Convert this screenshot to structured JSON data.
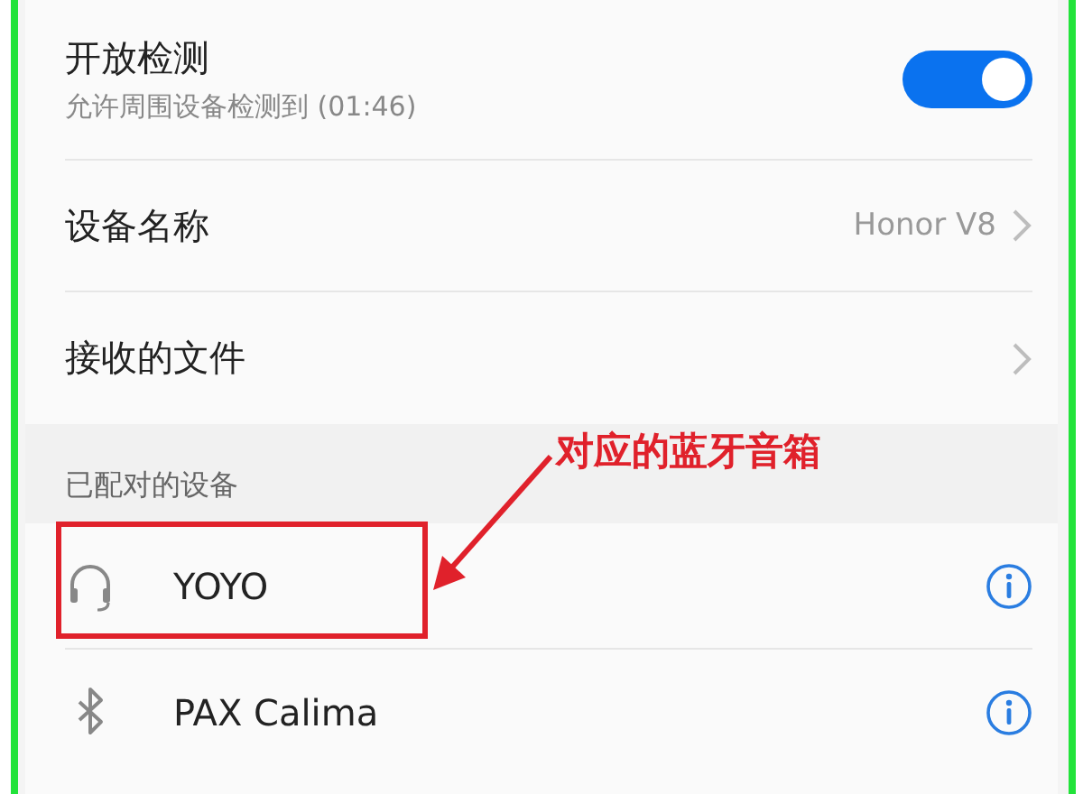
{
  "visibility": {
    "title": "开放检测",
    "subtitle": "允许周围设备检测到 (01:46)",
    "on": true
  },
  "device_name": {
    "label": "设备名称",
    "value": "Honor V8"
  },
  "received_files": {
    "label": "接收的文件"
  },
  "paired_section": {
    "header": "已配对的设备",
    "devices": [
      {
        "name": "YOYO",
        "kind": "headset"
      },
      {
        "name": "PAX Calima",
        "kind": "bluetooth"
      }
    ]
  },
  "annotation": {
    "label": "对应的蓝牙音箱"
  }
}
